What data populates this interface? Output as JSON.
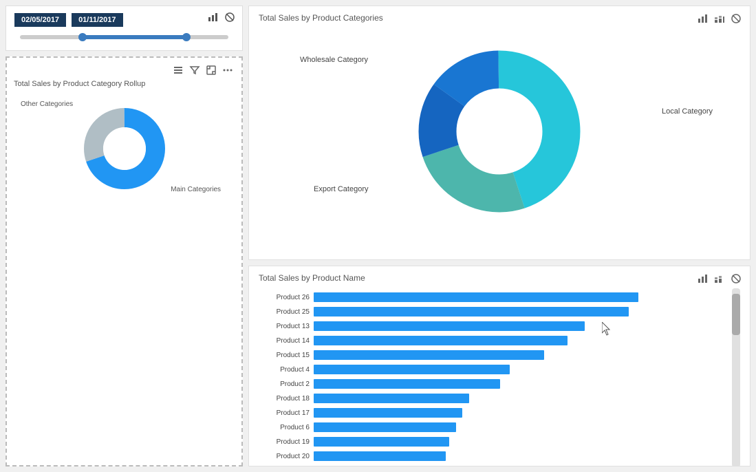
{
  "dates": {
    "start": "02/05/2017",
    "end": "01/11/2017"
  },
  "smallDonut": {
    "title": "Total Sales by Product Category Rollup",
    "labels": [
      "Other Categories",
      "Main Categories"
    ]
  },
  "donut": {
    "title": "Total Sales by Product Categories",
    "labels": [
      "Wholesale Category",
      "Local Category",
      "Export Category"
    ]
  },
  "barChart": {
    "title": "Total Sales by Product Name",
    "bars": [
      {
        "label": "Product 26",
        "pct": 96
      },
      {
        "label": "Product 25",
        "pct": 93
      },
      {
        "label": "Product 13",
        "pct": 80
      },
      {
        "label": "Product 14",
        "pct": 75
      },
      {
        "label": "Product 15",
        "pct": 68
      },
      {
        "label": "Product 4",
        "pct": 58
      },
      {
        "label": "Product 2",
        "pct": 55
      },
      {
        "label": "Product 18",
        "pct": 46
      },
      {
        "label": "Product 17",
        "pct": 44
      },
      {
        "label": "Product 6",
        "pct": 42
      },
      {
        "label": "Product 19",
        "pct": 40
      },
      {
        "label": "Product 20",
        "pct": 39
      }
    ]
  },
  "icons": {
    "bar_chart": "📊",
    "stacked_bar": "📈",
    "block": "⊘"
  }
}
